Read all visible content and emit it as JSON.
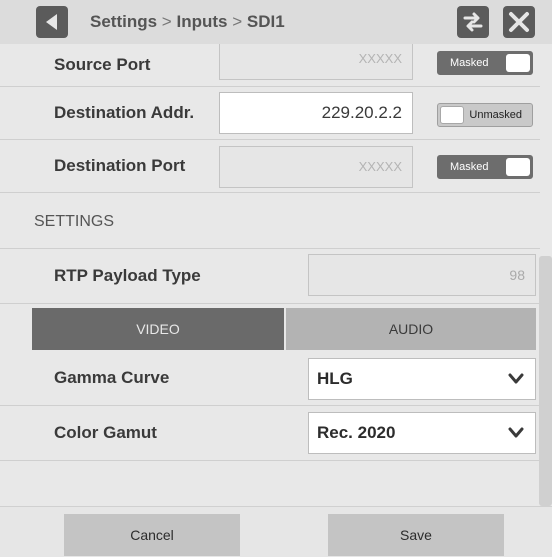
{
  "header": {
    "breadcrumb": [
      "Settings",
      "Inputs",
      "SDI1"
    ],
    "separator": ">",
    "back_icon": "back-arrow-icon",
    "swap_icon": "swap-arrows-icon",
    "close_icon": "close-x-icon"
  },
  "fields": {
    "source_port": {
      "label": "Source Port",
      "value": "XXXXX",
      "toggle": "Masked"
    },
    "destination_addr": {
      "label": "Destination Addr.",
      "value": "229.20.2.2",
      "toggle": "Unmasked"
    },
    "destination_port": {
      "label": "Destination Port",
      "value": "XXXXX",
      "toggle": "Masked"
    }
  },
  "settings": {
    "section_title": "SETTINGS",
    "rtp_payload_type": {
      "label": "RTP Payload Type",
      "value": "98"
    },
    "tabs": [
      {
        "label": "VIDEO",
        "active": true
      },
      {
        "label": "AUDIO",
        "active": false
      }
    ],
    "gamma_curve": {
      "label": "Gamma Curve",
      "value": "HLG"
    },
    "color_gamut": {
      "label": "Color Gamut",
      "value": "Rec. 2020"
    }
  },
  "footer": {
    "cancel_label": "Cancel",
    "save_label": "Save"
  },
  "colors": {
    "header_button": "#5b5b5b",
    "active_tab": "#6a6a6a",
    "inactive_tab": "#b3b3b3"
  }
}
